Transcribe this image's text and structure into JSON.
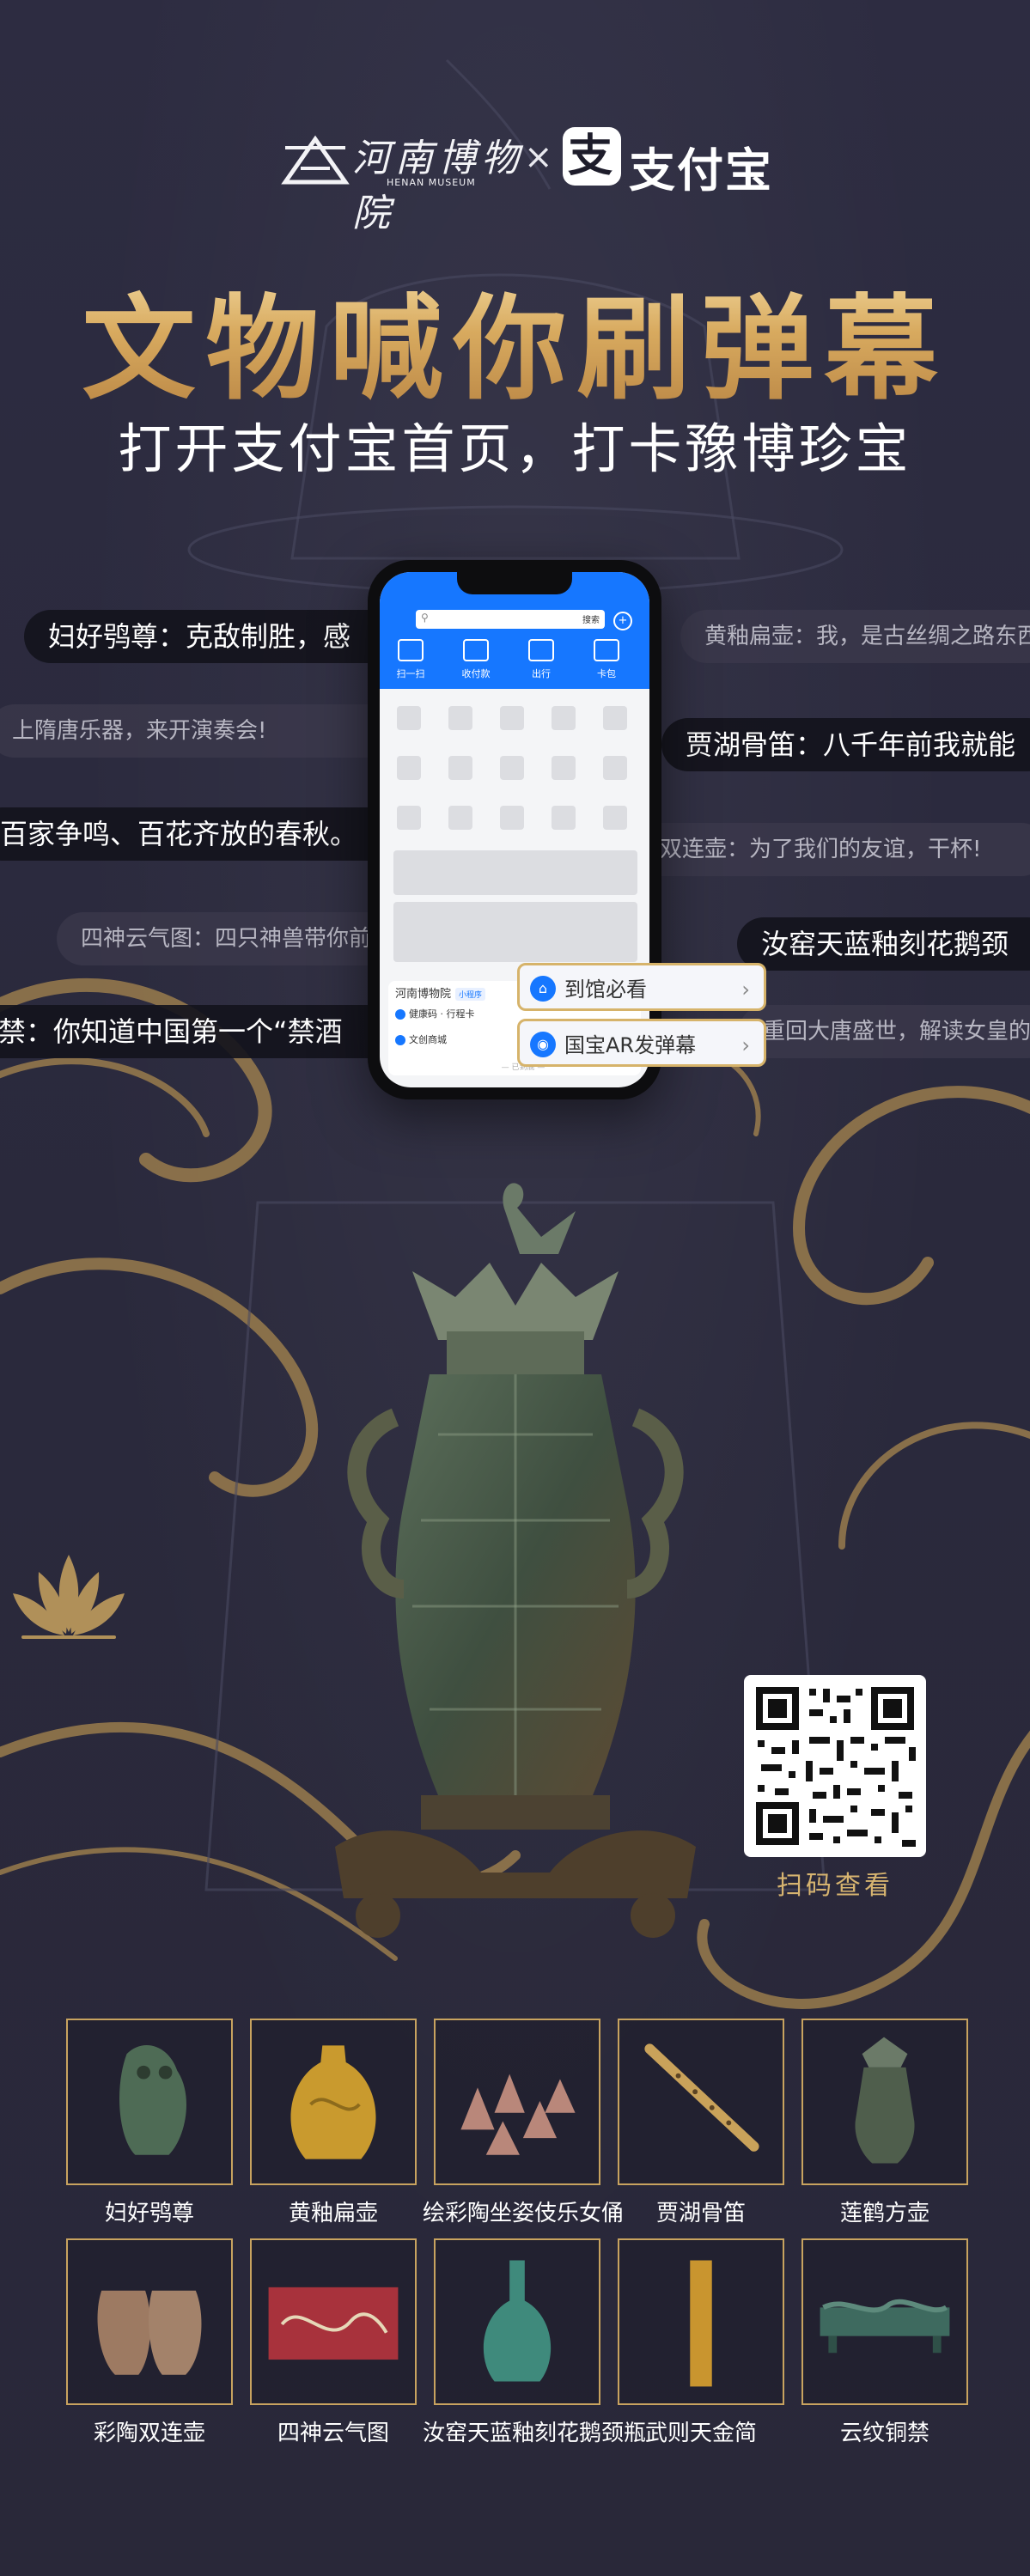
{
  "header": {
    "museum_cn": "河南博物院",
    "museum_en": "HENAN MUSEUM",
    "cross": "×",
    "alipay_glyph": "支",
    "alipay_name": "支付宝"
  },
  "title": "文物喊你刷弹幕",
  "subtitle": "打开支付宝首页，打卡豫博珍宝",
  "danmaku": [
    {
      "text": "妇好鸮尊：克敌制胜，感"
    },
    {
      "text": "黄釉扁壶：我，是古丝绸之路东西"
    },
    {
      "text": "上隋唐乐器，来开演奏会!"
    },
    {
      "text": "贾湖骨笛：八千年前我就能"
    },
    {
      "text": "百家争鸣、百花齐放的春秋。"
    },
    {
      "text": "双连壶：为了我们的友谊，干杯!"
    },
    {
      "text": "四神云气图：四只神兽带你前往"
    },
    {
      "text": "汝窑天蓝釉刻花鹅颈"
    },
    {
      "text": "禁：你知道中国第一个“禁酒"
    },
    {
      "text": "重回大唐盛世，解读女皇的祈福"
    }
  ],
  "phone": {
    "search_button": "搜索",
    "quick_actions": [
      "扫一扫",
      "收付款",
      "出行",
      "卡包"
    ],
    "mini_card_title": "河南博物院",
    "mini_card_tag": "小程序",
    "mini_rows": [
      "健康码 · 行程卡",
      "文创商城"
    ],
    "mini_footer": "— 已到底 —"
  },
  "popups": [
    {
      "label": "到馆必看",
      "icon": "museum-icon"
    },
    {
      "label": "国宝AR发弹幕",
      "icon": "location-icon"
    }
  ],
  "qr_label": "扫码查看",
  "artifacts": [
    {
      "name": "妇好鸮尊"
    },
    {
      "name": "黄釉扁壶"
    },
    {
      "name": "绘彩陶坐姿伎乐女俑"
    },
    {
      "name": "贾湖骨笛"
    },
    {
      "name": "莲鹤方壶"
    },
    {
      "name": "彩陶双连壶"
    },
    {
      "name": "四神云气图"
    },
    {
      "name": "汝窑天蓝釉刻花鹅颈瓶"
    },
    {
      "name": "武则天金简"
    },
    {
      "name": "云纹铜禁"
    }
  ],
  "colors": {
    "background": "#2b2a3d",
    "gold": "#c8a35f",
    "alipay_blue": "#1677ff"
  }
}
